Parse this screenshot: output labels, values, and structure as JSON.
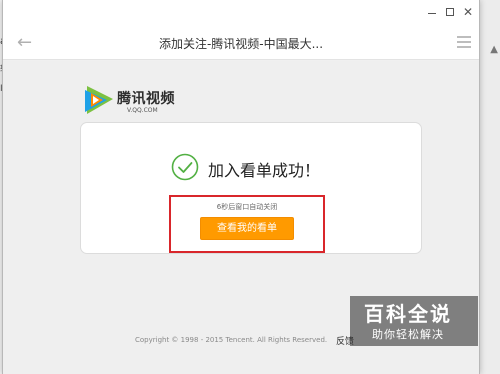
{
  "background": {
    "frag1": "aic",
    "frag2": "转给",
    "frag3": "Ⅰ"
  },
  "window": {
    "title": "添加关注-腾讯视频-中国最大...",
    "back_icon": "arrow-left-icon",
    "menu_icon": "hamburger-icon",
    "controls": [
      "minimize",
      "maximize",
      "close"
    ]
  },
  "logo": {
    "brand": "腾讯视频",
    "domain": "V.QQ.COM"
  },
  "card": {
    "success_text": "加入看单成功！",
    "countdown_text": "6秒后窗口自动关闭",
    "button_label": "查看我的看单"
  },
  "footer": {
    "copyright": "Copyright © 1998 - 2015 Tencent. All Rights Reserved.",
    "feedback": "反馈"
  },
  "watermark": {
    "title": "百科全说",
    "subtitle": "助你轻松解决"
  },
  "colors": {
    "accent": "#ff9a00",
    "highlight_border": "#d9262b",
    "check": "#52b043",
    "logo_blue": "#1ea1e7",
    "logo_green": "#7cc142",
    "logo_orange": "#ff8a00"
  }
}
